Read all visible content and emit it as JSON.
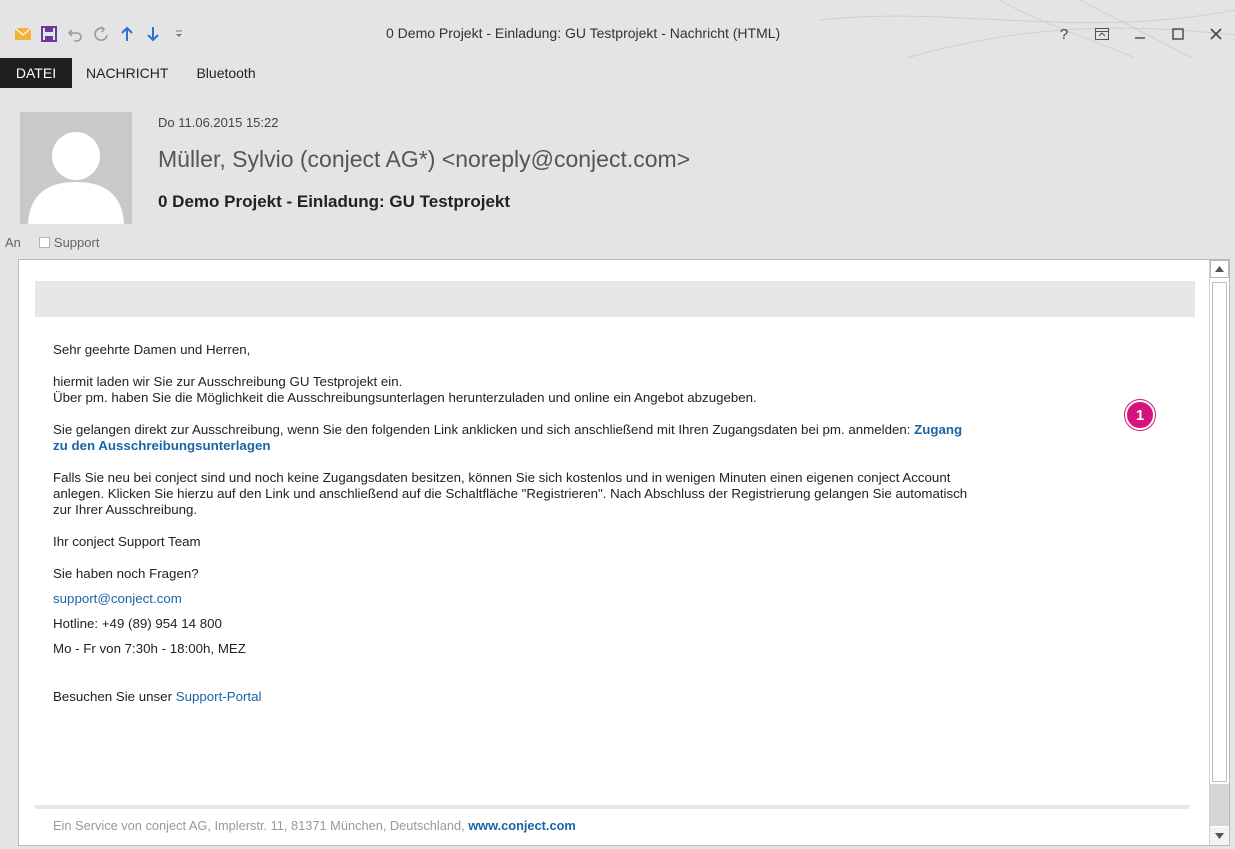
{
  "window": {
    "title": "0 Demo Projekt - Einladung: GU Testprojekt - Nachricht (HTML)",
    "help": "?",
    "controls": [
      "restore-ribbon",
      "minimize",
      "maximize",
      "close"
    ]
  },
  "qat_icons": [
    "envelope-icon",
    "save-icon",
    "undo-icon",
    "redo-icon",
    "up-arrow-icon",
    "down-arrow-icon",
    "customize-icon"
  ],
  "tabs": [
    {
      "label": "DATEI"
    },
    {
      "label": "NACHRICHT"
    },
    {
      "label": "Bluetooth"
    }
  ],
  "message": {
    "date": "Do 11.06.2015 15:22",
    "from": "Müller, Sylvio (conject AG*) <noreply@conject.com>",
    "subject": "0 Demo Projekt - Einladung: GU Testprojekt",
    "to_label": "An",
    "to_recipient": "Support"
  },
  "body": {
    "greeting": "Sehr geehrte Damen und Herren,",
    "p1_line1": "hiermit laden wir Sie zur Ausschreibung GU Testprojekt ein.",
    "p1_line2": "Über pm. haben Sie die Möglichkeit die Ausschreibungsunterlagen herunterzuladen und online ein Angebot abzugeben.",
    "p2_text": "Sie gelangen direkt zur Ausschreibung, wenn Sie den folgenden Link anklicken und sich anschließend mit Ihren Zugangsdaten bei pm. anmelden: ",
    "p2_link_part1": "Zugang",
    "p2_link_part2": "zu den Ausschreibungsunterlagen",
    "p3_line1": "Falls Sie neu bei conject sind und noch keine Zugangsdaten besitzen, können Sie sich kostenlos und in wenigen Minuten einen eigenen conject Account",
    "p3_line2": "anlegen. Klicken Sie hierzu auf den Link und anschließend auf die Schaltfläche \"Registrieren\". Nach Abschluss der Registrierung gelangen Sie automatisch",
    "p3_line3": "zur Ihrer Ausschreibung.",
    "signoff": "Ihr conject Support Team",
    "questions": "Sie haben noch Fragen?",
    "email": "support@conject.com",
    "hotline": "Hotline: +49 (89) 954 14 800",
    "hours": "Mo - Fr von 7:30h - 18:00h, MEZ",
    "portal_prefix": "Besuchen Sie unser ",
    "portal_link": "Support-Portal",
    "footer_text": "Ein Service von conject AG, Implerstr. 11, 81371 München, Deutschland, ",
    "footer_link": "www.conject.com"
  },
  "badge": {
    "number": "1",
    "color": "#d6127c"
  },
  "colors": {
    "link": "#1a64a8",
    "file_tab": "#1f1f1f",
    "save_icon": "#6b3a9f",
    "envelope_icon": "#f2b33d"
  }
}
